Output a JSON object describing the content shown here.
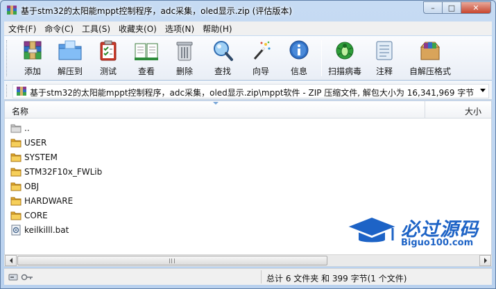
{
  "window": {
    "title": "基于stm32的太阳能mppt控制程序，adc采集，oled显示.zip (评估版本)"
  },
  "window_controls": {
    "minimize": "–",
    "maximize": "□",
    "close": "✕"
  },
  "menu": [
    {
      "label": "文件(F)"
    },
    {
      "label": "命令(C)"
    },
    {
      "label": "工具(S)"
    },
    {
      "label": "收藏夹(O)"
    },
    {
      "label": "选项(N)"
    },
    {
      "label": "帮助(H)"
    }
  ],
  "toolbar": {
    "add": "添加",
    "extract_to": "解压到",
    "test": "测试",
    "view": "查看",
    "delete": "删除",
    "find": "查找",
    "wizard": "向导",
    "info": "信息",
    "scan_virus": "扫描病毒",
    "comment": "注释",
    "sfx": "自解压格式"
  },
  "address": {
    "path": "基于stm32的太阳能mppt控制程序，adc采集，oled显示.zip\\mppt软件 - ZIP 压缩文件, 解包大小为 16,341,969 字节"
  },
  "list": {
    "columns": {
      "name": "名称",
      "size": "大小"
    },
    "rows": [
      {
        "name": "..",
        "icon": "folder-up-icon"
      },
      {
        "name": "USER",
        "icon": "folder-icon"
      },
      {
        "name": "SYSTEM",
        "icon": "folder-icon"
      },
      {
        "name": "STM32F10x_FWLib",
        "icon": "folder-icon"
      },
      {
        "name": "OBJ",
        "icon": "folder-icon"
      },
      {
        "name": "HARDWARE",
        "icon": "folder-icon"
      },
      {
        "name": "CORE",
        "icon": "folder-icon"
      },
      {
        "name": "keilkilll.bat",
        "icon": "batch-file-icon"
      }
    ]
  },
  "status": {
    "summary": "总计 6 文件夹 和 399 字节(1 个文件)"
  },
  "watermark": {
    "title": "必过源码",
    "subtitle": "Biguo100.com"
  },
  "colors": {
    "accent": "#1d63c6",
    "folder": "#f1c24a",
    "title_bar": "#c6dbf3"
  }
}
